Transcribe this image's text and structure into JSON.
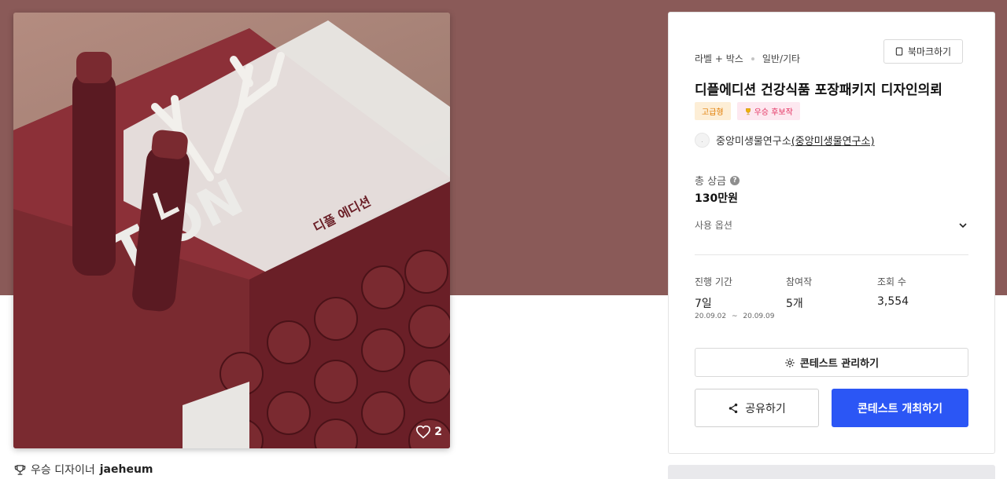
{
  "product": {
    "likes": "2",
    "image_alt": "product-package-photo"
  },
  "winner": {
    "label": "우승 디자이너",
    "name": "jaeheum"
  },
  "contest": {
    "category_primary": "라벨 + 박스",
    "category_secondary": "일반/기타",
    "bookmark_label": "북마크하기",
    "title": "디플에디션 건강식품 포장패키지 디자인의뢰",
    "badges": {
      "premium": "고급형",
      "winner_candidate": "우승 후보작"
    },
    "host": {
      "name": "중앙미생물연구소",
      "link_text": "(중앙미생물연구소)",
      "logo_text": "."
    },
    "prize_label": "총 상금",
    "prize_value": "130만원",
    "options_label": "사용 옵션",
    "stats": {
      "period_label": "진행 기간",
      "period_value": "7일",
      "period_start": "20.09.02",
      "period_sep": "~",
      "period_end": "20.09.09",
      "participants_label": "참여작",
      "participants_value": "5개",
      "views_label": "조회 수",
      "views_value": "3,554"
    },
    "manage_label": "콘테스트 관리하기",
    "share_label": "공유하기",
    "host_contest_label": "콘테스트 개최하기"
  },
  "colors": {
    "hero_bg": "#8a5a58",
    "primary": "#2b56f5",
    "premium_badge": "#e07b00",
    "winner_badge": "#e3305f"
  }
}
